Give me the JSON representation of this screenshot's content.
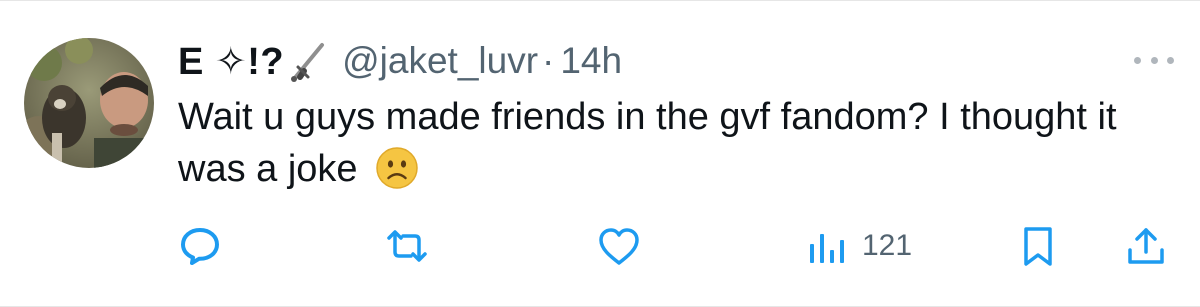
{
  "tweet": {
    "display_name": "E ✧!?",
    "handle": "@jaket_luvr",
    "separator": "·",
    "time": "14h",
    "text": "Wait u guys made friends in the gvf fandom? I thought it was a joke",
    "emoji": "frowning-face"
  },
  "actions": {
    "reply_icon": "reply-icon",
    "retweet_icon": "retweet-icon",
    "like_icon": "heart-icon",
    "views_icon": "views-icon",
    "views_count": "121",
    "bookmark_icon": "bookmark-icon",
    "share_icon": "share-icon",
    "more_icon": "more-icon"
  },
  "colors": {
    "text": "#0f1419",
    "secondary": "#536471",
    "icon": "#1d9bf0",
    "emoji": "#f5c542"
  }
}
